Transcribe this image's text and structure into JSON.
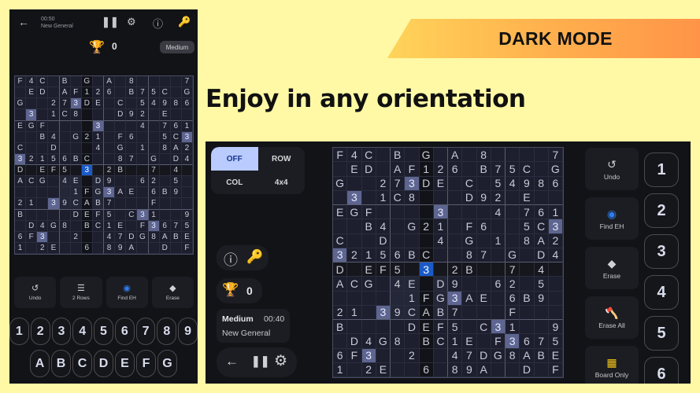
{
  "banner": {
    "text": "DARK MODE"
  },
  "headline": "Enjoy in any orientation",
  "colors": {
    "background": "#fff9a6",
    "app_bg": "#121317",
    "board_bg": "#1d1f2e",
    "selected_cell": "#1a5bc8",
    "same_value_cell": "#5d6590",
    "mode_active": "#b9cbff"
  },
  "portrait": {
    "back_icon": "arrow-left-icon",
    "timer": "00:50",
    "game_type": "New General",
    "header_icons": [
      "pause-icon",
      "gear-icon",
      "info-icon",
      "key-icon"
    ],
    "score": "0",
    "difficulty": "Medium",
    "tools": [
      {
        "icon": "undo-icon",
        "label": "Undo"
      },
      {
        "icon": "two-rows-icon",
        "label": "2 Rows"
      },
      {
        "icon": "find-icon",
        "label": "Find EH"
      },
      {
        "icon": "eraser-icon",
        "label": "Erase"
      }
    ],
    "number_keys": [
      "1",
      "2",
      "3",
      "4",
      "5",
      "6",
      "7",
      "8",
      "9"
    ],
    "letter_keys": [
      "A",
      "B",
      "C",
      "D",
      "E",
      "F",
      "G"
    ]
  },
  "landscape": {
    "modes": [
      "OFF",
      "ROW",
      "COL",
      "4x4"
    ],
    "active_mode": "OFF",
    "score": "0",
    "difficulty": "Medium",
    "timer": "00:40",
    "game_type": "New General",
    "tools": [
      {
        "icon": "undo-icon",
        "label": "Undo"
      },
      {
        "icon": "find-icon",
        "label": "Find EH"
      },
      {
        "icon": "eraser-icon",
        "label": "Erase"
      },
      {
        "icon": "axe-icon",
        "label": "Erase All"
      },
      {
        "icon": "grid-icon",
        "label": "Board Only"
      }
    ],
    "number_keys": [
      "1",
      "2",
      "3",
      "4",
      "5",
      "6"
    ]
  },
  "board": {
    "size": 16,
    "selected": [
      8,
      6
    ],
    "highlight_value": "3",
    "rows": [
      [
        "F",
        "4",
        "C",
        "",
        "B",
        "",
        "G",
        "",
        "A",
        "",
        "8",
        "",
        "",
        "",
        "",
        "7"
      ],
      [
        "",
        "E",
        "D",
        "",
        "A",
        "F",
        "1",
        "2",
        "6",
        "",
        "B",
        "7",
        "5",
        "C",
        "",
        "G"
      ],
      [
        "G",
        "",
        "",
        "2",
        "7",
        "3",
        "D",
        "E",
        "",
        "C",
        "",
        "5",
        "4",
        "9",
        "8",
        "6"
      ],
      [
        "",
        "3",
        "",
        "1",
        "C",
        "8",
        "",
        "",
        "",
        "D",
        "9",
        "2",
        "",
        "E",
        "",
        ""
      ],
      [
        "E",
        "G",
        "F",
        "",
        "",
        "",
        "",
        "3",
        "",
        "",
        "",
        "4",
        "",
        "7",
        "6",
        "1"
      ],
      [
        "",
        "",
        "B",
        "4",
        "",
        "G",
        "2",
        "1",
        "",
        "F",
        "6",
        "",
        "",
        "5",
        "C",
        "3"
      ],
      [
        "C",
        "",
        "",
        "D",
        "",
        "",
        "",
        "4",
        "",
        "G",
        "",
        "1",
        "",
        "8",
        "A",
        "2"
      ],
      [
        "3",
        "2",
        "1",
        "5",
        "6",
        "B",
        "C",
        "",
        "",
        "8",
        "7",
        "",
        "G",
        "",
        "D",
        "4"
      ],
      [
        "D",
        "",
        "E",
        "F",
        "5",
        "",
        "3",
        "",
        "2",
        "B",
        "",
        "",
        "7",
        "",
        "4",
        ""
      ],
      [
        "A",
        "C",
        "G",
        "",
        "4",
        "E",
        "",
        "D",
        "9",
        "",
        "",
        "6",
        "2",
        "",
        "5",
        ""
      ],
      [
        "",
        "",
        "",
        "",
        "",
        "1",
        "F",
        "G",
        "3",
        "A",
        "E",
        "",
        "6",
        "B",
        "9",
        ""
      ],
      [
        "2",
        "1",
        "",
        "3",
        "9",
        "C",
        "A",
        "B",
        "7",
        "",
        "",
        "",
        "F",
        "",
        "",
        ""
      ],
      [
        "B",
        "",
        "",
        "",
        "",
        "D",
        "E",
        "F",
        "5",
        "",
        "C",
        "3",
        "1",
        "",
        "",
        "9"
      ],
      [
        "",
        "D",
        "4",
        "G",
        "8",
        "",
        "B",
        "C",
        "1",
        "E",
        "",
        "F",
        "3",
        "6",
        "7",
        "5"
      ],
      [
        "6",
        "F",
        "3",
        "",
        "",
        "2",
        "",
        "",
        "4",
        "7",
        "D",
        "G",
        "8",
        "A",
        "B",
        "E"
      ],
      [
        "1",
        "",
        "2",
        "E",
        "",
        "",
        "6",
        "",
        "8",
        "9",
        "A",
        "",
        "",
        "D",
        "",
        "F"
      ]
    ]
  }
}
